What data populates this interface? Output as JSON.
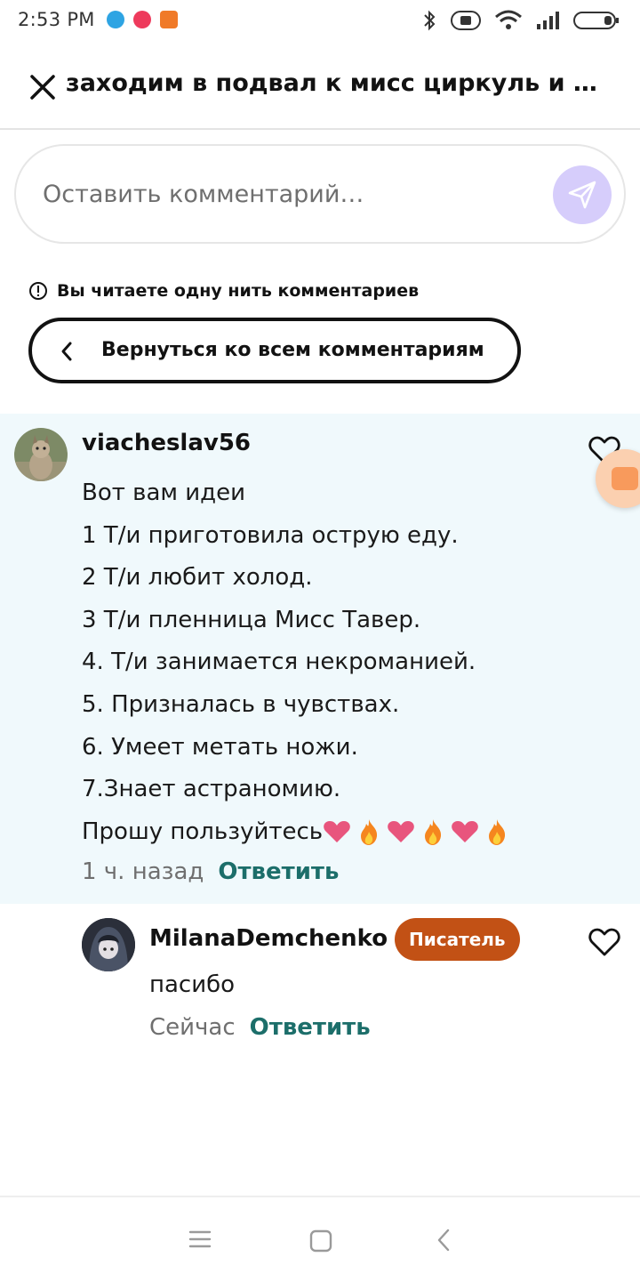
{
  "status_bar": {
    "time": "2:53 PM",
    "notification_icons": [
      "telegram-icon",
      "music-icon",
      "ok-icon"
    ],
    "system_icons": [
      "bluetooth-icon",
      "vibrate-icon",
      "wifi-icon",
      "signal-icon",
      "battery-icon"
    ]
  },
  "header": {
    "title": "заходим в подвал к мисс циркуль и п…"
  },
  "comment_input": {
    "placeholder": "Оставить комментарий…"
  },
  "thread": {
    "info_text": "Вы читаете одну нить комментариев",
    "back_label": "Вернуться ко всем комментариям"
  },
  "main_comment": {
    "username": "viacheslav56",
    "lines": [
      "Вот вам идеи",
      "1 Т/и приготовила острую еду.",
      "2 Т/и любит холод.",
      "3 Т/и пленница Мисс Тавер.",
      "4. Т/и занимается некроманией.",
      "5. Призналась в чувствах.",
      "6. Умеет метать ножи.",
      "7.Знает астраномию.",
      "Прошу пользуйтесь"
    ],
    "emoji_suffix": [
      "heart-emoji",
      "fire-emoji",
      "heart-emoji",
      "fire-emoji",
      "heart-emoji",
      "fire-emoji"
    ],
    "time": "1 ч. назад",
    "reply_label": "Ответить"
  },
  "reply": {
    "username": "MilanaDemchenko",
    "badge": "Писатель",
    "text": "пасибо",
    "time": "Сейчас",
    "reply_label": "Ответить"
  },
  "colors": {
    "thread_bg": "#f0f9fc",
    "reply_link": "#1c6e6a",
    "badge": "#c25115",
    "send_button": "#d6cdfb"
  }
}
